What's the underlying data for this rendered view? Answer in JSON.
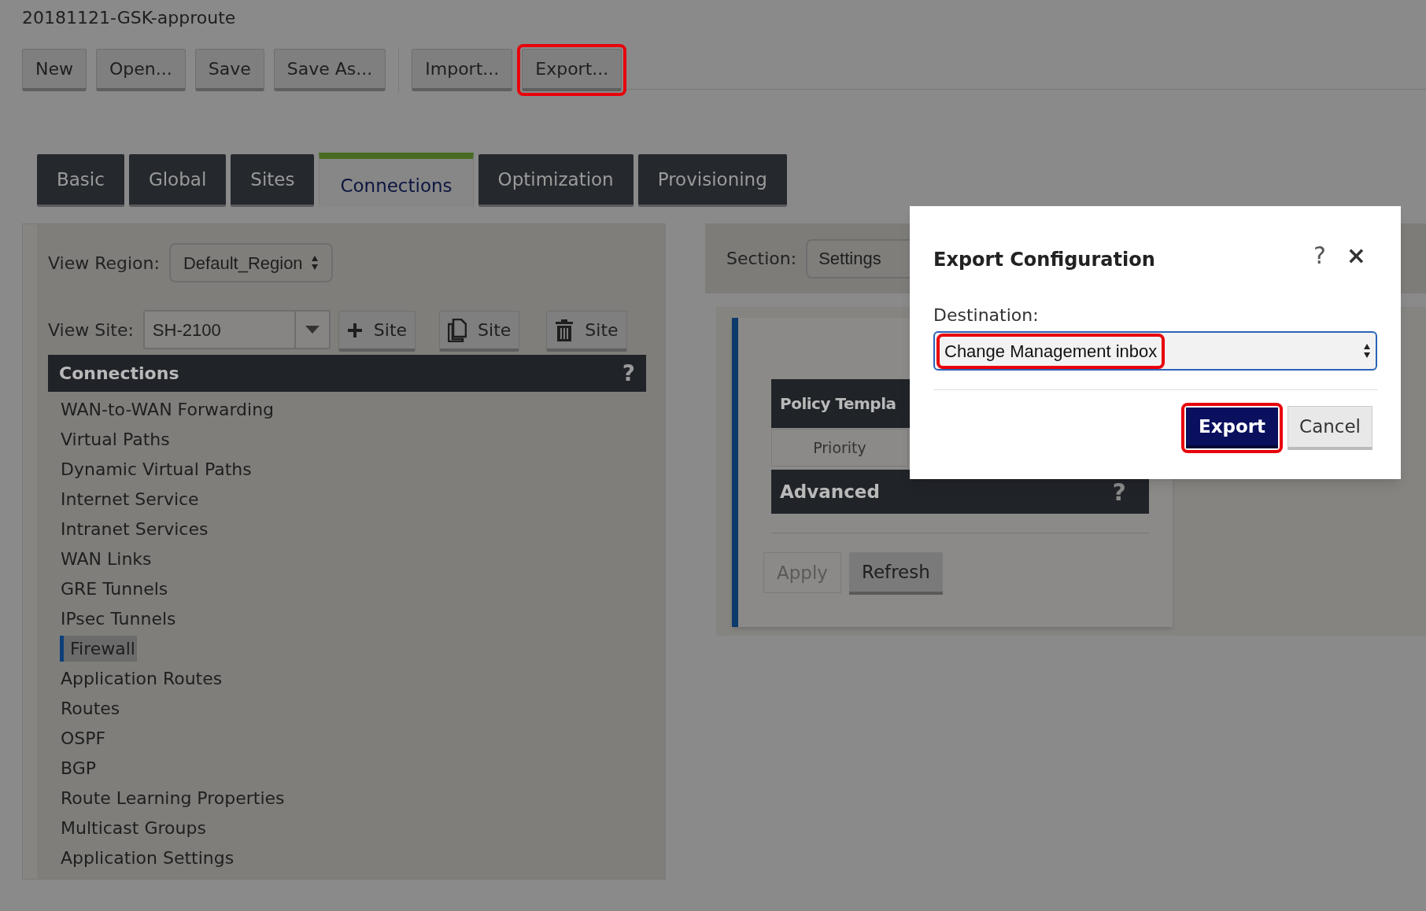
{
  "document_title": "20181121-GSK-approute",
  "toolbar_groups": [
    [
      {
        "label": "New",
        "highlighted": false
      },
      {
        "label": "Open...",
        "highlighted": false
      },
      {
        "label": "Save",
        "highlighted": false
      },
      {
        "label": "Save As...",
        "highlighted": false
      }
    ],
    [
      {
        "label": "Import...",
        "highlighted": false
      },
      {
        "label": "Export...",
        "highlighted": true
      }
    ]
  ],
  "tabs": [
    {
      "label": "Basic",
      "selected": false
    },
    {
      "label": "Global",
      "selected": false
    },
    {
      "label": "Sites",
      "selected": false
    },
    {
      "label": "Connections",
      "selected": true
    },
    {
      "label": "Optimization",
      "selected": false
    },
    {
      "label": "Provisioning",
      "selected": false
    }
  ],
  "view_region": {
    "label": "View Region:",
    "value": "Default_Region"
  },
  "view_site": {
    "label": "View Site:",
    "value": "SH-2100"
  },
  "site_buttons": [
    {
      "kind": "add",
      "label": "Site"
    },
    {
      "kind": "copy",
      "label": "Site"
    },
    {
      "kind": "delete",
      "label": "Site"
    }
  ],
  "connections": {
    "title": "Connections",
    "help": "?",
    "items": [
      {
        "label": "WAN-to-WAN Forwarding",
        "selected": false
      },
      {
        "label": "Virtual Paths",
        "selected": false
      },
      {
        "label": "Dynamic Virtual Paths",
        "selected": false
      },
      {
        "label": "Internet Service",
        "selected": false
      },
      {
        "label": "Intranet Services",
        "selected": false
      },
      {
        "label": "WAN Links",
        "selected": false
      },
      {
        "label": "GRE Tunnels",
        "selected": false
      },
      {
        "label": "IPsec Tunnels",
        "selected": false
      },
      {
        "label": "Firewall",
        "selected": true
      },
      {
        "label": "Application Routes",
        "selected": false
      },
      {
        "label": "Routes",
        "selected": false
      },
      {
        "label": "OSPF",
        "selected": false
      },
      {
        "label": "BGP",
        "selected": false
      },
      {
        "label": "Route Learning Properties",
        "selected": false
      },
      {
        "label": "Multicast Groups",
        "selected": false
      },
      {
        "label": "Application Settings",
        "selected": false
      }
    ]
  },
  "section": {
    "label": "Section:",
    "value": "Settings"
  },
  "card": {
    "policy_header": "Policy Templa",
    "priority": "Priority",
    "advanced": "Advanced",
    "advanced_help": "?",
    "buttons": [
      {
        "label": "Apply",
        "disabled": true
      },
      {
        "label": "Refresh",
        "disabled": false
      }
    ]
  },
  "dialog": {
    "title": "Export Configuration",
    "help": "?",
    "close": "×",
    "destination_label": "Destination:",
    "destination": {
      "value": "Change Management inbox",
      "highlighted": true
    },
    "buttons": [
      {
        "kind": "primary",
        "label": "Export",
        "highlighted": true
      },
      {
        "kind": "secondary",
        "label": "Cancel",
        "highlighted": false
      }
    ]
  }
}
